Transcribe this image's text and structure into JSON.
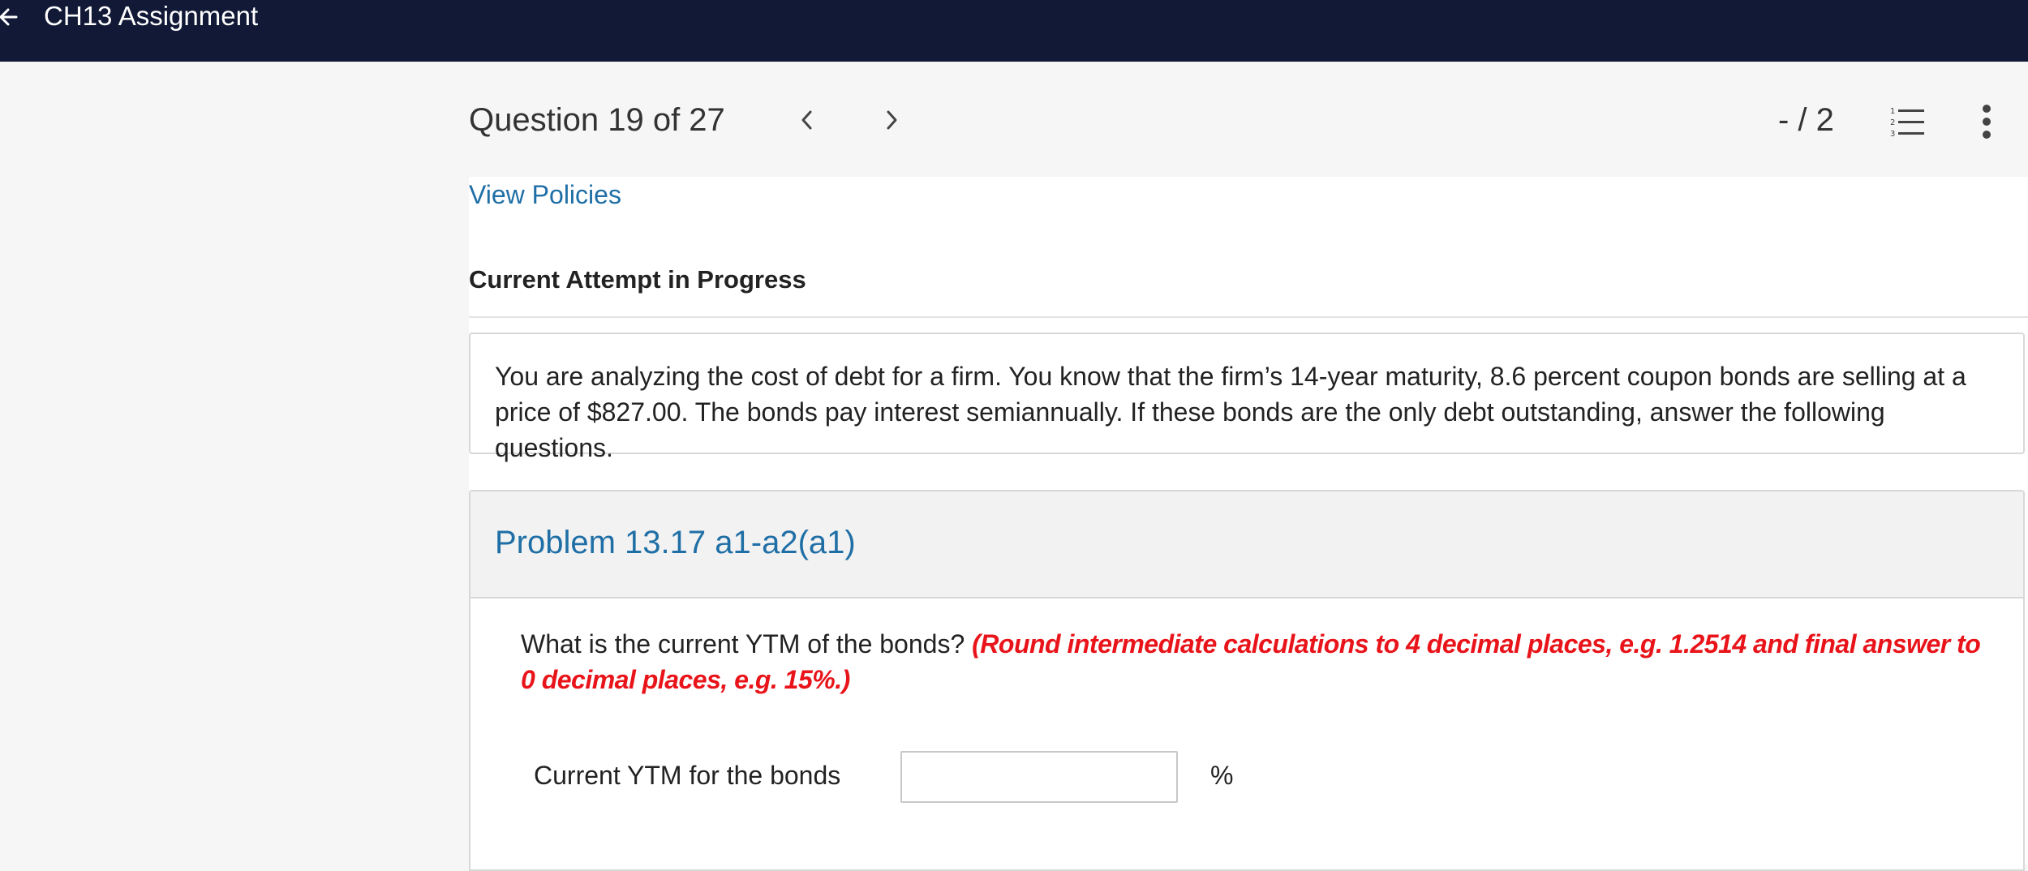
{
  "header": {
    "title": "CH13 Assignment",
    "back_icon": "arrow-left-icon"
  },
  "question_nav": {
    "title": "Question 19 of 27",
    "prev_icon": "chevron-left-icon",
    "next_icon": "chevron-right-icon",
    "score": "- / 2",
    "list_icon": "numbered-list-icon",
    "more_icon": "more-vertical-icon"
  },
  "links": {
    "view_policies": "View Policies"
  },
  "attempt": {
    "status": "Current Attempt in Progress"
  },
  "stem": {
    "text": "You are analyzing the cost of debt for a firm. You know that the firm’s 14-year maturity, 8.6 percent coupon bonds are selling at a price of $827.00. The bonds pay interest semiannually. If these bonds are the only debt outstanding, answer the following questions."
  },
  "problem": {
    "title": "Problem 13.17 a1-a2(a1)",
    "question": "What is the current YTM of the bonds?",
    "hint": "(Round intermediate calculations to 4 decimal places, e.g. 1.2514 and final answer to 0 decimal places, e.g. 15%.)",
    "answer_label": "Current YTM for the bonds",
    "answer_value": "",
    "answer_unit": "%"
  },
  "colors": {
    "topbar": "#111936",
    "link": "#1f6fa6",
    "hint": "#e8141a"
  }
}
